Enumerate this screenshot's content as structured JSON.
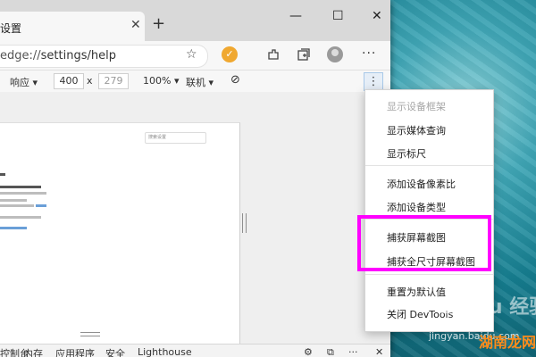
{
  "browser": {
    "tab_title": "设置",
    "new_tab_glyph": "+",
    "url_scheme": "edge://",
    "url_path": "settings/help",
    "toolbar_icons": [
      "star-icon",
      "extension-icon",
      "extensions-icon",
      "collections-icon",
      "profile-avatar",
      "more-icon"
    ],
    "window_controls": {
      "minimize": "—",
      "maximize": "☐",
      "close": "✕"
    }
  },
  "devtools_bar": {
    "responsive_label": "响应 ▾",
    "width": "400",
    "times": "x",
    "height": "279",
    "zoom": "100% ▾",
    "network": "联机 ▾"
  },
  "device_preview": {
    "search_placeholder": "搜索设置"
  },
  "context_menu": {
    "items": [
      {
        "label": "显示设备框架",
        "disabled": true
      },
      {
        "label": "显示媒体查询",
        "disabled": false
      },
      {
        "label": "显示标尺",
        "disabled": false
      },
      {
        "label": "添加设备像素比",
        "disabled": false
      },
      {
        "label": "添加设备类型",
        "disabled": false
      },
      {
        "label": "捕获屏幕截图",
        "disabled": false
      },
      {
        "label": "捕获全尺寸屏幕截图",
        "disabled": false
      },
      {
        "label": "重置为默认值",
        "disabled": false
      },
      {
        "label": "关闭 DevTools",
        "disabled": false
      }
    ],
    "highlight_color": "#ff00ff"
  },
  "bottom_tabs": [
    "控制台",
    "内存",
    "应用程序",
    "安全",
    "Lighthouse"
  ],
  "watermark": {
    "baidu": "Baidu 经验",
    "site": "jingyan.baidu.com",
    "brand": "湖南龙网"
  }
}
